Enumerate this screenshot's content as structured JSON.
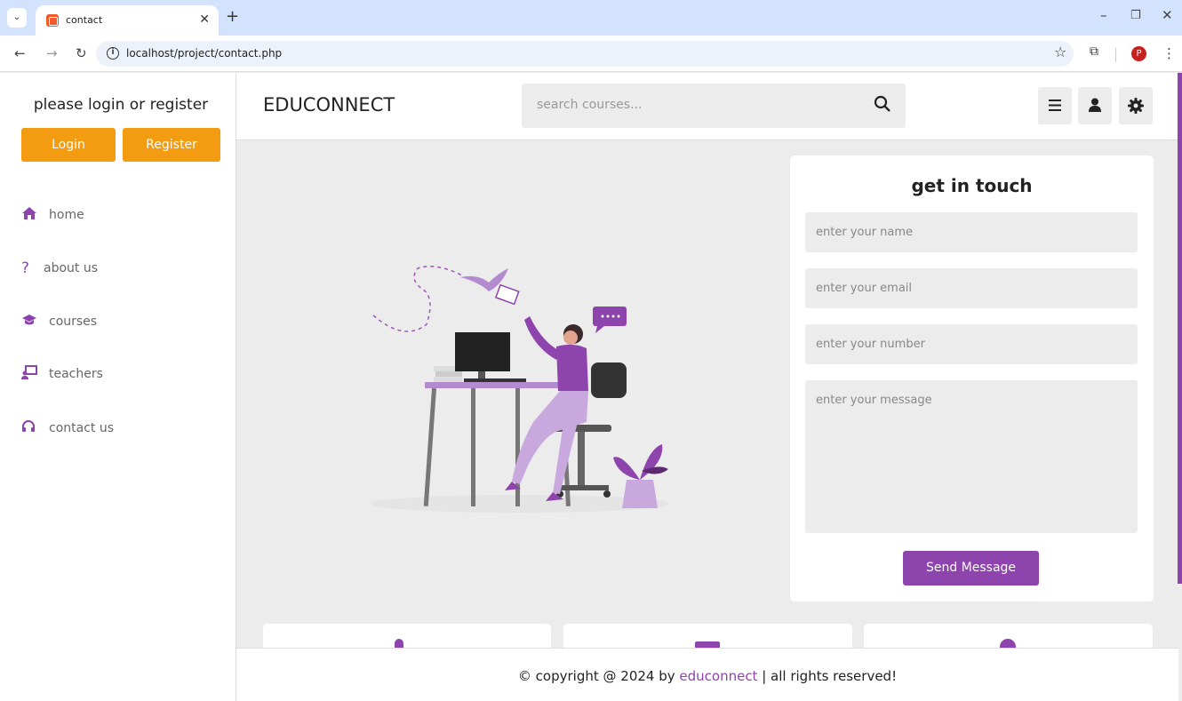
{
  "browser": {
    "tab_title": "contact",
    "url": "localhost/project/contact.php",
    "profile_initial": "P"
  },
  "sidebar": {
    "title": "please login or register",
    "login_label": "Login",
    "register_label": "Register",
    "items": [
      {
        "label": "home",
        "icon": "home-icon"
      },
      {
        "label": "about us",
        "icon": "question-icon"
      },
      {
        "label": "courses",
        "icon": "graduation-cap-icon"
      },
      {
        "label": "teachers",
        "icon": "chalkboard-teacher-icon"
      },
      {
        "label": "contact us",
        "icon": "headset-icon"
      }
    ]
  },
  "header": {
    "brand": "EDUCONNECT",
    "search_placeholder": "search courses..."
  },
  "form": {
    "title": "get in touch",
    "name_placeholder": "enter your name",
    "email_placeholder": "enter your email",
    "number_placeholder": "enter your number",
    "message_placeholder": "enter your message",
    "submit_label": "Send Message"
  },
  "footer": {
    "prefix": "© copyright @ 2024 by ",
    "brand": "educonnect",
    "suffix": " | all rights reserved!"
  },
  "colors": {
    "accent": "#8e44ad",
    "button_orange": "#f39c12",
    "background": "#ececec"
  }
}
